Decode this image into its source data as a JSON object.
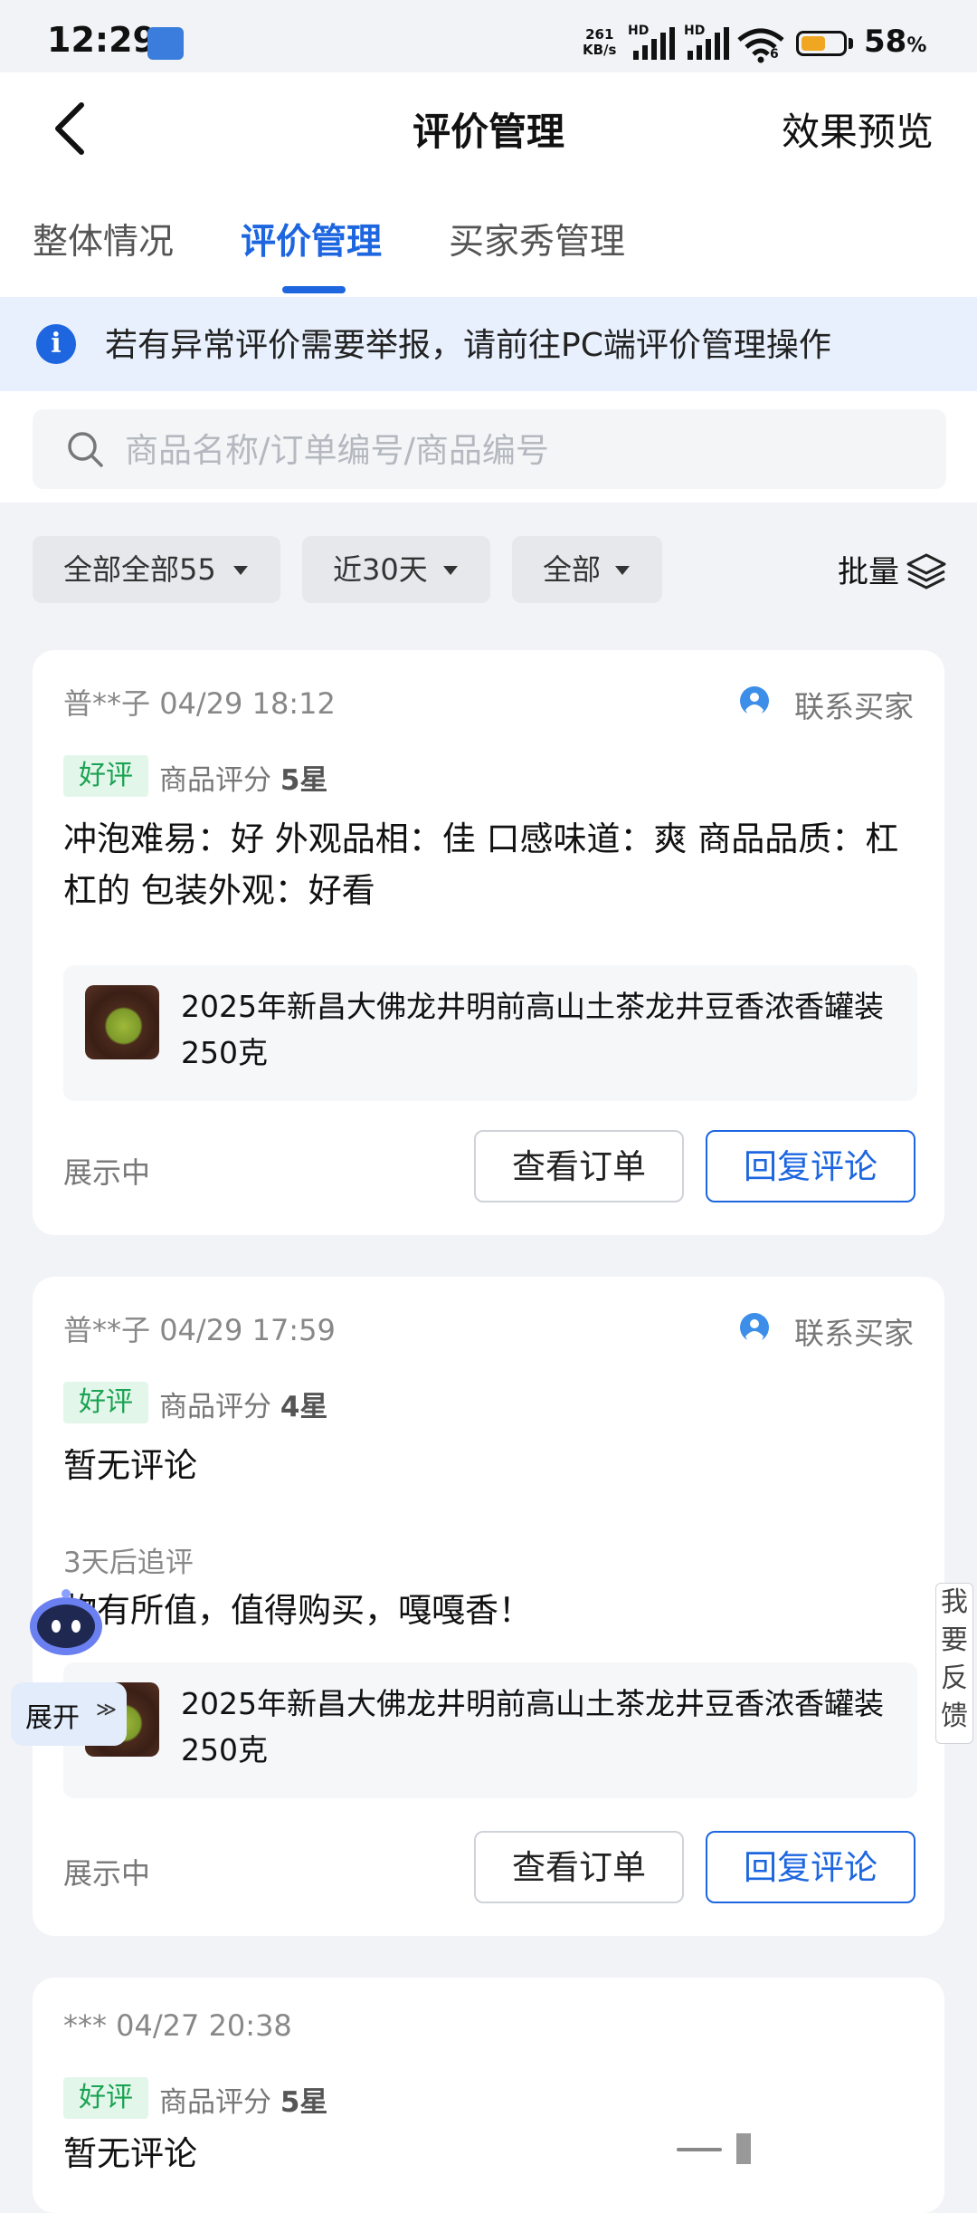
{
  "status_bar": {
    "time": "12:29",
    "net_speed_value": "261",
    "net_speed_unit": "KB/s",
    "hd": "HD",
    "wifi_label": "6",
    "battery_percent": "58",
    "battery_unit": "%",
    "battery_level": 0.58
  },
  "nav": {
    "back": "back",
    "title": "评价管理",
    "preview": "效果预览"
  },
  "tabs": [
    {
      "label": "整体情况"
    },
    {
      "label": "评价管理",
      "active": true
    },
    {
      "label": "买家秀管理"
    }
  ],
  "notice": {
    "icon_text": "i",
    "text": "若有异常评价需要举报，请前往PC端评价管理操作"
  },
  "search": {
    "placeholder": "商品名称/订单编号/商品编号"
  },
  "filters": {
    "type": "全部全部55",
    "period": "近30天",
    "status": "全部",
    "batch": "批量"
  },
  "reviews": [
    {
      "buyer": "普**子",
      "datetime": "04/29 18:12",
      "contact": "联系买家",
      "tag": "好评",
      "rating_label": "商品评分",
      "stars": "5星",
      "comment": "冲泡难易：好 外观品相：佳 口感味道：爽 商品品质：杠杠的 包装外观：好看",
      "product": "2025年新昌大佛龙井明前高山土茶龙井豆香浓香罐装250克",
      "status": "展示中",
      "view_order": "查看订单",
      "reply": "回复评论"
    },
    {
      "buyer": "普**子",
      "datetime": "04/29 17:59",
      "contact": "联系买家",
      "tag": "好评",
      "rating_label": "商品评分",
      "stars": "4星",
      "comment": "暂无评论",
      "followup_label": "3天后追评",
      "followup": "物有所值，值得购买，嘎嘎香！",
      "product": "2025年新昌大佛龙井明前高山土茶龙井豆香浓香罐装250克",
      "status": "展示中",
      "view_order": "查看订单",
      "reply": "回复评论"
    },
    {
      "buyer": "***",
      "datetime": "04/27 20:38",
      "tag": "好评",
      "rating_label": "商品评分",
      "stars": "5星",
      "comment": "暂无评论"
    }
  ],
  "floating": {
    "expand": "展开",
    "expand_chevron": "≫",
    "feedback": "我要反馈"
  },
  "colors": {
    "accent": "#1d66e0",
    "good_tag_bg": "#e3f6ea",
    "good_tag_text": "#1aa352",
    "notice_bg": "#e8f0fd",
    "page_bg": "#f2f3f6"
  }
}
